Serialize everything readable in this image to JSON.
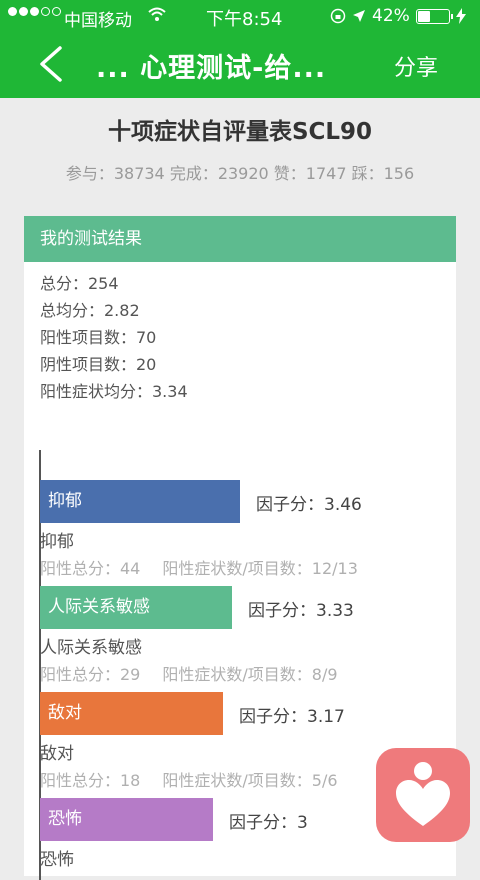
{
  "status": {
    "carrier": "中国移动",
    "time": "下午8:54",
    "battery": "42%"
  },
  "nav": {
    "back_icon": "chevron-left-icon",
    "title": "...  心理测试-给...",
    "share_label": "分享"
  },
  "page": {
    "title": "十项症状自评量表SCL90",
    "stats": "参与：38734 完成：23920 赞：1747 踩：156"
  },
  "result": {
    "header": "我的测试结果",
    "total_score": "总分：254",
    "avg_score": "总均分：2.82",
    "positive_count": "阳性项目数：70",
    "negative_count": "阴性项目数：20",
    "positive_avg": "阳性症状均分：3.34"
  },
  "factors": [
    {
      "bar_label": "抑郁",
      "score_text": "因子分：3.46",
      "value": 3.46,
      "color": "#4a6fad",
      "name": "抑郁",
      "positive_total": "阳性总分：44",
      "positive_ratio": "阳性症状数/项目数：12/13"
    },
    {
      "bar_label": "人际关系敏感",
      "score_text": "因子分：3.33",
      "value": 3.33,
      "color": "#5dbb8f",
      "name": "人际关系敏感",
      "positive_total": "阳性总分：29",
      "positive_ratio": "阳性症状数/项目数：8/9"
    },
    {
      "bar_label": "敌对",
      "score_text": "因子分：3.17",
      "value": 3.17,
      "color": "#e8763c",
      "name": "敌对",
      "positive_total": "阳性总分：18",
      "positive_ratio": "阳性症状数/项目数：5/6"
    },
    {
      "bar_label": "恐怖",
      "score_text": "因子分：3",
      "value": 3,
      "color": "#b57bc7",
      "name": "恐怖",
      "positive_total": "",
      "positive_ratio": ""
    }
  ],
  "floating_button": {
    "icon": "heart-person-icon",
    "color": "#ef7a7c"
  }
}
